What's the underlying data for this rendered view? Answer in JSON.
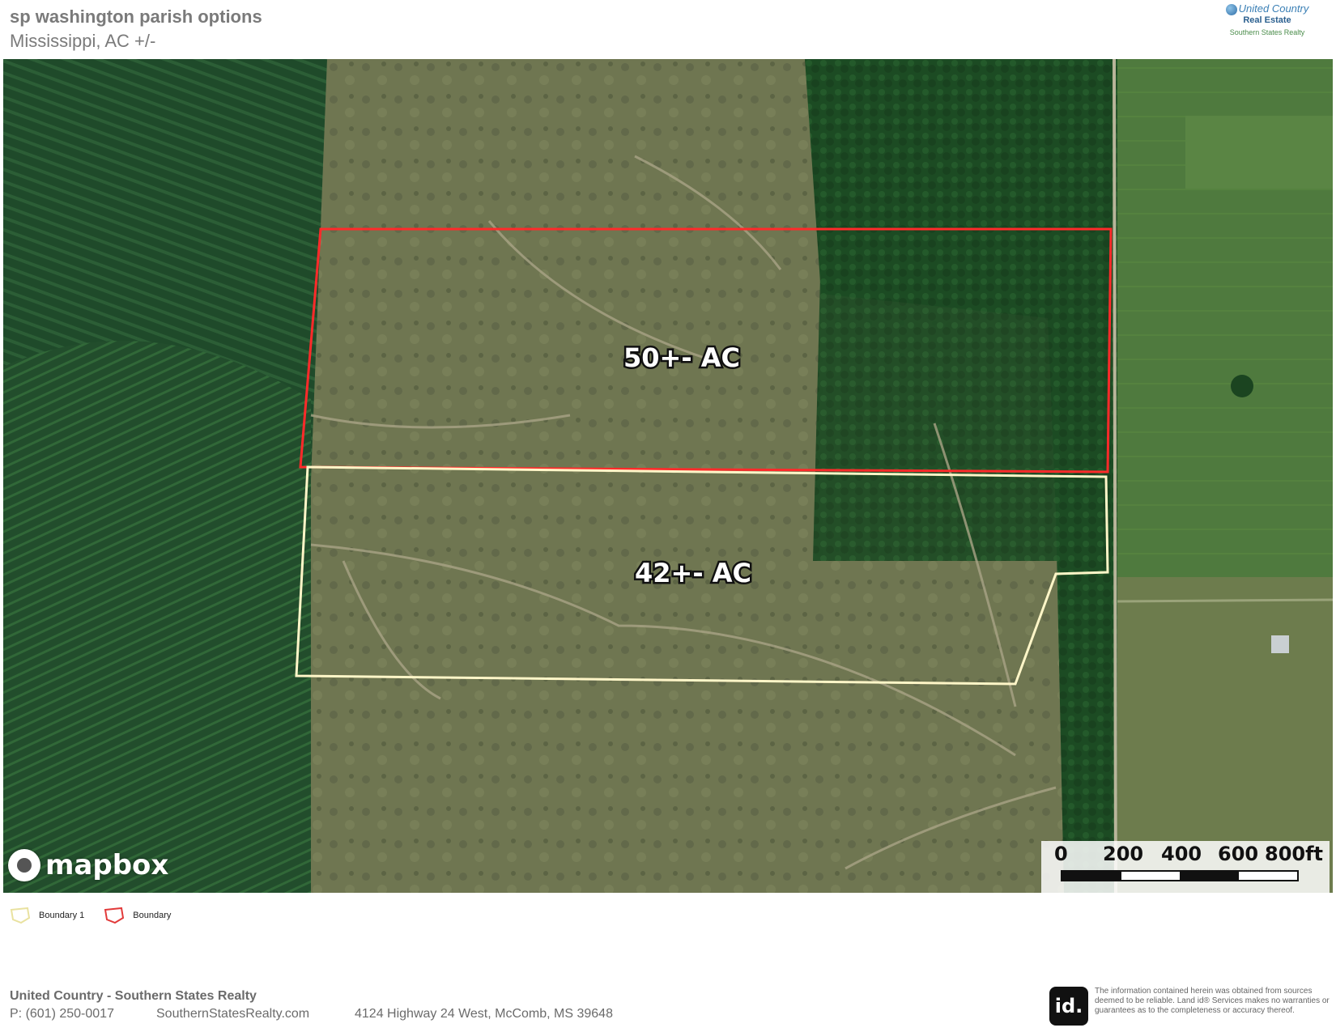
{
  "header": {
    "title": "sp washington parish options",
    "subtitle": "Mississippi,  AC +/-"
  },
  "logo": {
    "line1": "United Country",
    "line2": "Real Estate",
    "line3": "Southern States Realty"
  },
  "map": {
    "parcels": [
      {
        "label": "50+- AC",
        "color": "#ff2a2a"
      },
      {
        "label": "42+- AC",
        "color": "#fff6c8"
      }
    ],
    "attribution": "mapbox",
    "scale_ticks": [
      "0",
      "200",
      "400",
      "600",
      "800ft"
    ]
  },
  "legend": {
    "items": [
      {
        "label": "Boundary 1",
        "color": "#e9e2a0"
      },
      {
        "label": "Boundary",
        "color": "#e23a3a"
      }
    ]
  },
  "footer": {
    "company": "United Country - Southern States Realty",
    "phone": "P: (601) 250-0017",
    "website": "SouthernStatesRealty.com",
    "address": "4124 Highway 24 West, McComb, MS 39648"
  },
  "disclaimer": {
    "logo_text": "id.",
    "text": "The information contained herein was obtained from sources deemed to be reliable. Land id® Services makes no warranties or guarantees as to the completeness or accuracy thereof."
  }
}
